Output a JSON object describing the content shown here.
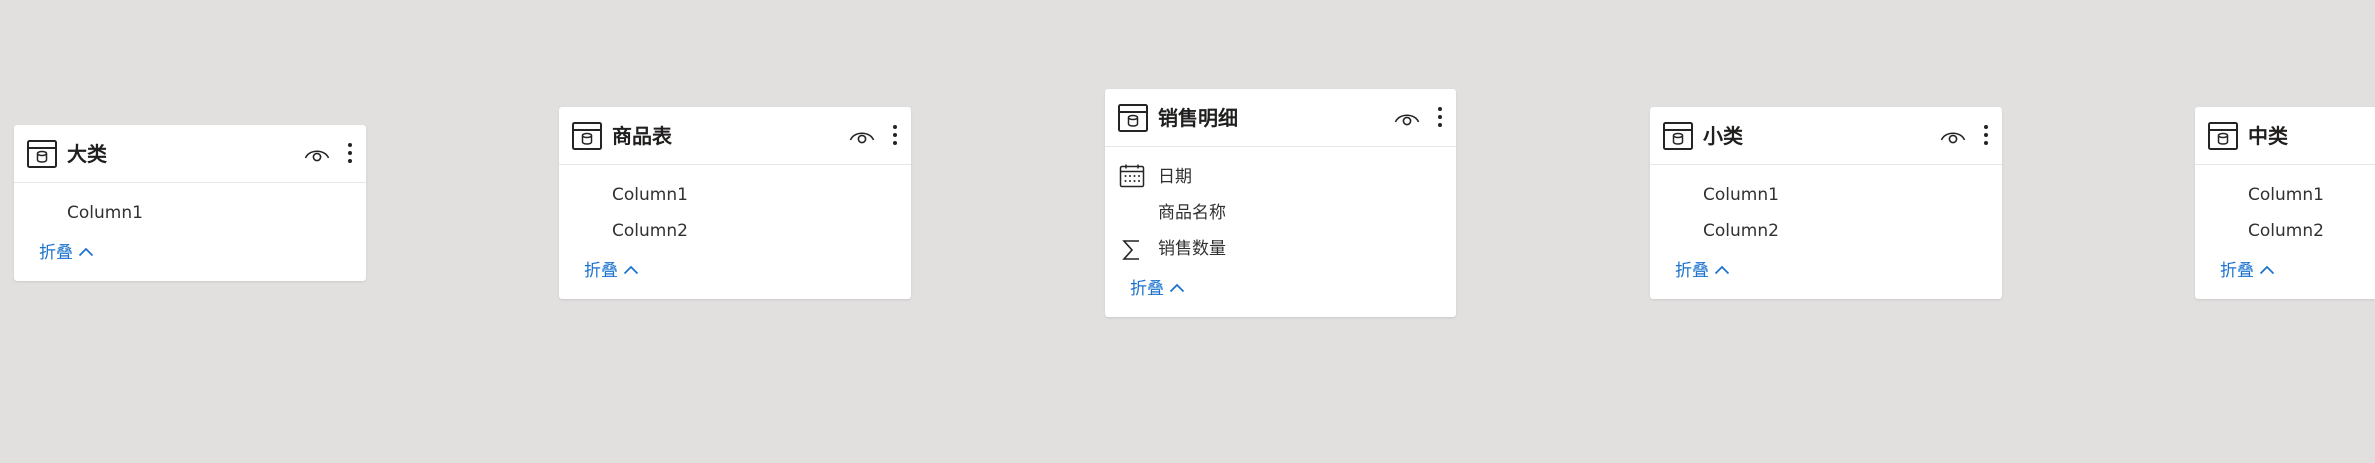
{
  "tables": {
    "dalei": {
      "title": "大类",
      "fields": [
        "Column1"
      ],
      "collapse_label": "折叠"
    },
    "shangpin": {
      "title": "商品表",
      "fields": [
        "Column1",
        "Column2"
      ],
      "collapse_label": "折叠"
    },
    "xiaoshou": {
      "title": "销售明细",
      "fields": [
        "日期",
        "商品名称",
        "销售数量"
      ],
      "field_icons": [
        "calendar-icon",
        "",
        "sigma-icon"
      ],
      "collapse_label": "折叠"
    },
    "xiaolei": {
      "title": "小类",
      "fields": [
        "Column1",
        "Column2"
      ],
      "collapse_label": "折叠"
    },
    "zhonglei": {
      "title": "中类",
      "fields": [
        "Column1",
        "Column2"
      ],
      "collapse_label": "折叠"
    }
  },
  "colors": {
    "canvas": "#e1e0df",
    "card": "#ffffff",
    "link": "#1a72cf"
  }
}
